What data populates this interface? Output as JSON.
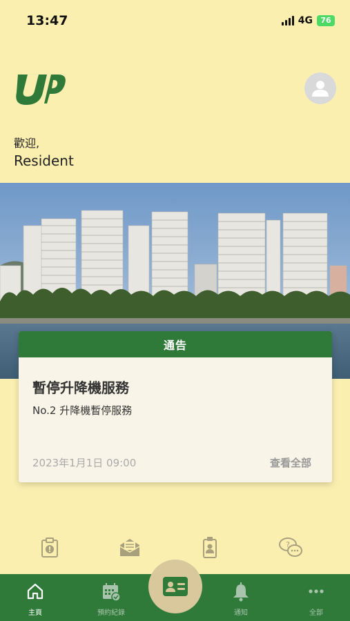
{
  "status_bar": {
    "time": "13:47",
    "network": "4G",
    "battery": "76"
  },
  "header": {
    "welcome": "歡迎,",
    "user_name": "Resident"
  },
  "notice": {
    "header": "通告",
    "title": "暫停升降機服務",
    "subtitle": "No.2 升降機暫停服務",
    "date": "2023年1月1日 09:00",
    "view_all": "查看全部"
  },
  "quick_icons": [
    "clipboard-alert-icon",
    "mail-icon",
    "id-badge-icon",
    "chat-question-icon"
  ],
  "bottom_nav": {
    "items": [
      {
        "label": "主頁",
        "icon": "home-icon",
        "active": true
      },
      {
        "label": "預約紀錄",
        "icon": "calendar-check-icon",
        "active": false
      },
      {
        "label": "通知",
        "icon": "bell-icon",
        "active": false
      },
      {
        "label": "全部",
        "icon": "more-dots-icon",
        "active": false
      }
    ],
    "center_icon": "id-card-icon"
  },
  "colors": {
    "background": "#fbefb0",
    "brand_green": "#2f7a39",
    "fab": "#d9c89c"
  }
}
